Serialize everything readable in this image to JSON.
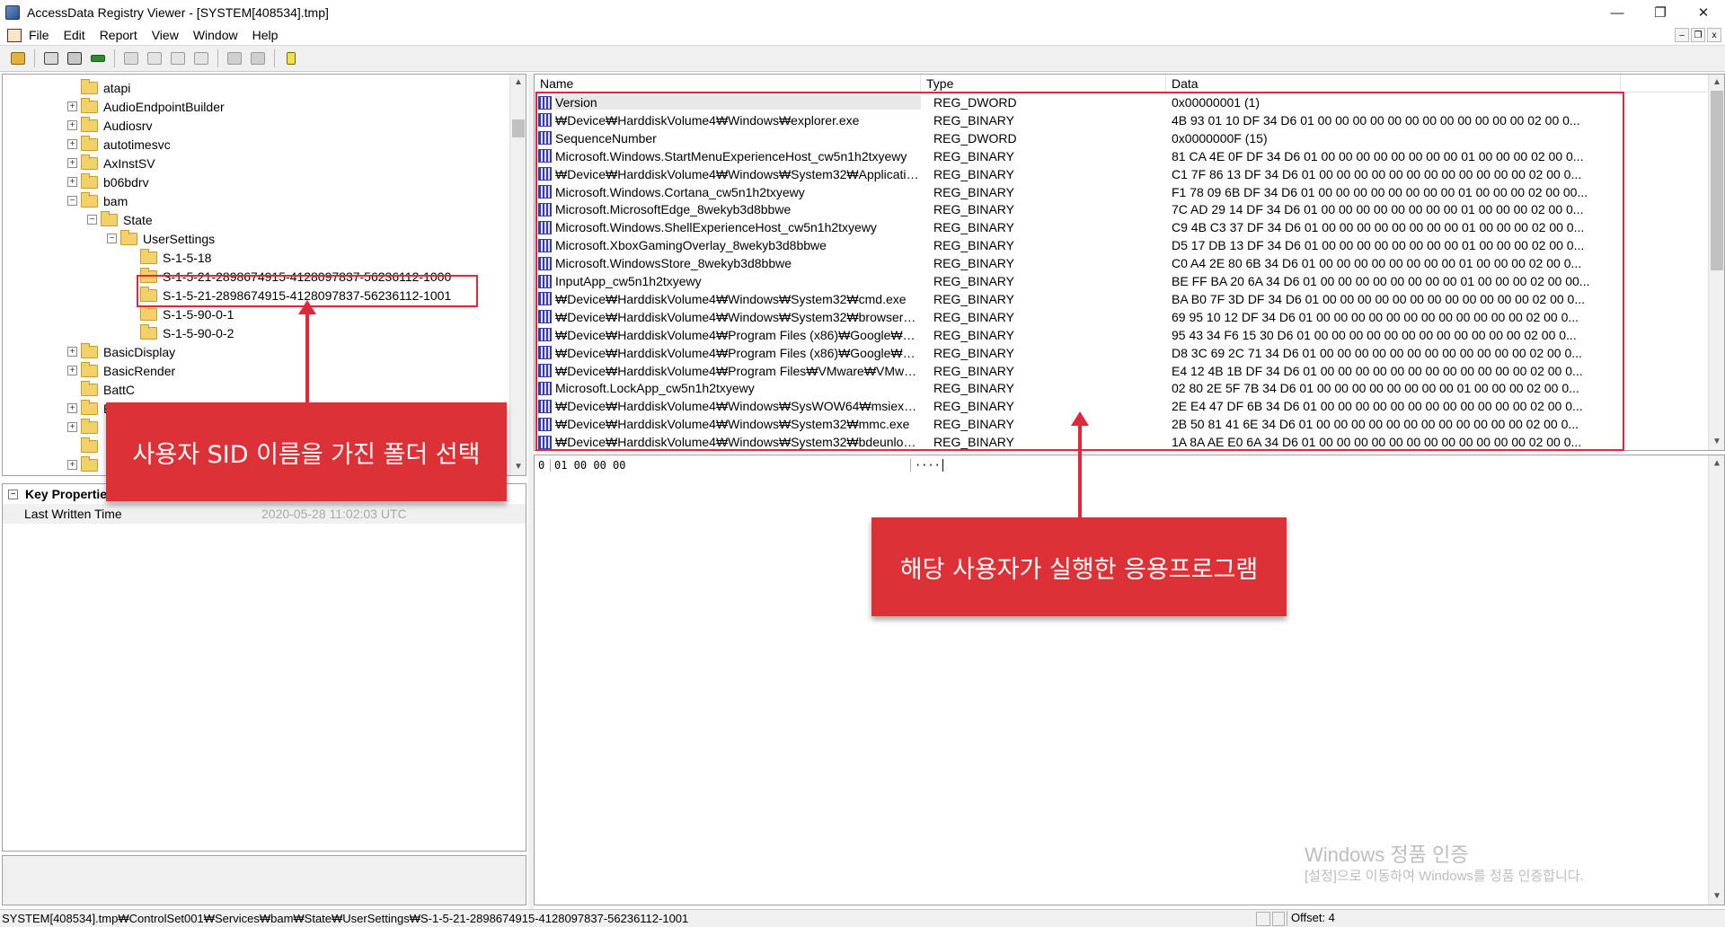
{
  "window": {
    "title": "AccessData Registry Viewer - [SYSTEM[408534].tmp]",
    "minimize_glyph": "—",
    "maximize_glyph": "❐",
    "close_glyph": "✕"
  },
  "menu": {
    "items": [
      "File",
      "Edit",
      "Report",
      "View",
      "Window",
      "Help"
    ],
    "mdi_min": "–",
    "mdi_restore": "❐",
    "mdi_close": "x"
  },
  "toolbar": {
    "icons": [
      "open-icon",
      "print-icon",
      "print-preview-icon",
      "key-icon",
      "export-icon",
      "report-icon",
      "report-add-icon",
      "report-remove-icon",
      "forward-icon",
      "back-icon",
      "help-icon"
    ]
  },
  "tree": {
    "expander_plus": "+",
    "expander_minus": "−",
    "items": [
      {
        "label": "atapi",
        "level": 1,
        "expander": "none"
      },
      {
        "label": "AudioEndpointBuilder",
        "level": 1,
        "expander": "plus"
      },
      {
        "label": "Audiosrv",
        "level": 1,
        "expander": "plus"
      },
      {
        "label": "autotimesvc",
        "level": 1,
        "expander": "plus"
      },
      {
        "label": "AxInstSV",
        "level": 1,
        "expander": "plus"
      },
      {
        "label": "b06bdrv",
        "level": 1,
        "expander": "plus"
      },
      {
        "label": "bam",
        "level": 1,
        "expander": "minus"
      },
      {
        "label": "State",
        "level": 2,
        "expander": "minus"
      },
      {
        "label": "UserSettings",
        "level": 3,
        "expander": "minus"
      },
      {
        "label": "S-1-5-18",
        "level": 4,
        "expander": "none"
      },
      {
        "label": "S-1-5-21-2898674915-4128097837-56236112-1000",
        "level": 4,
        "expander": "none"
      },
      {
        "label": "S-1-5-21-2898674915-4128097837-56236112-1001",
        "level": 4,
        "expander": "none",
        "selected": true
      },
      {
        "label": "S-1-5-90-0-1",
        "level": 4,
        "expander": "none"
      },
      {
        "label": "S-1-5-90-0-2",
        "level": 4,
        "expander": "none"
      },
      {
        "label": "BasicDisplay",
        "level": 1,
        "expander": "plus"
      },
      {
        "label": "BasicRender",
        "level": 1,
        "expander": "plus"
      },
      {
        "label": "BattC",
        "level": 1,
        "expander": "none"
      },
      {
        "label": "BcastDVRUserService",
        "level": 1,
        "expander": "plus"
      },
      {
        "label": "",
        "level": 1,
        "expander": "plus"
      },
      {
        "label": "",
        "level": 1,
        "expander": "none"
      },
      {
        "label": "",
        "level": 1,
        "expander": "plus"
      }
    ]
  },
  "key_properties": {
    "title": "Key Properties",
    "collapse": "−",
    "rows": [
      {
        "key": "Last Written Time",
        "value": "2020-05-28 11:02:03 UTC"
      }
    ]
  },
  "values_list": {
    "columns": [
      "Name",
      "Type",
      "Data"
    ],
    "rows": [
      {
        "name": "Version",
        "type": "REG_DWORD",
        "data": "0x00000001 (1)"
      },
      {
        "name": "₩Device₩HarddiskVolume4₩Windows₩explorer.exe",
        "type": "REG_BINARY",
        "data": "4B 93 01 10 DF 34 D6 01 00 00 00 00 00 00 00 00 00 00 00 00 02 00 0..."
      },
      {
        "name": "SequenceNumber",
        "type": "REG_DWORD",
        "data": "0x0000000F (15)"
      },
      {
        "name": "Microsoft.Windows.StartMenuExperienceHost_cw5n1h2txyewy",
        "type": "REG_BINARY",
        "data": "81 CA 4E 0F DF 34 D6 01 00 00 00 00 00 00 00 00 01 00 00 00 02 00 0..."
      },
      {
        "name": "₩Device₩HarddiskVolume4₩Windows₩System32₩Applicatio...",
        "type": "REG_BINARY",
        "data": "C1 7F 86 13 DF 34 D6 01 00 00 00 00 00 00 00 00 00 00 00 00 02 00 0..."
      },
      {
        "name": "Microsoft.Windows.Cortana_cw5n1h2txyewy",
        "type": "REG_BINARY",
        "data": "F1 78 09 6B DF 34 D6 01 00 00 00 00 00 00 00 00 01 00 00 00 02 00 00..."
      },
      {
        "name": "Microsoft.MicrosoftEdge_8wekyb3d8bbwe",
        "type": "REG_BINARY",
        "data": "7C AD 29 14 DF 34 D6 01 00 00 00 00 00 00 00 00 01 00 00 00 02 00 0..."
      },
      {
        "name": "Microsoft.Windows.ShellExperienceHost_cw5n1h2txyewy",
        "type": "REG_BINARY",
        "data": "C9 4B C3 37 DF 34 D6 01 00 00 00 00 00 00 00 00 01 00 00 00 02 00 0..."
      },
      {
        "name": "Microsoft.XboxGamingOverlay_8wekyb3d8bbwe",
        "type": "REG_BINARY",
        "data": "D5 17 DB 13 DF 34 D6 01 00 00 00 00 00 00 00 00 01 00 00 00 02 00 0..."
      },
      {
        "name": "Microsoft.WindowsStore_8wekyb3d8bbwe",
        "type": "REG_BINARY",
        "data": "C0 A4 2E 80 6B 34 D6 01 00 00 00 00 00 00 00 00 01 00 00 00 02 00 0..."
      },
      {
        "name": "InputApp_cw5n1h2txyewy",
        "type": "REG_BINARY",
        "data": "BE FF BA 20 6A 34 D6 01 00 00 00 00 00 00 00 00 01 00 00 00 02 00 00..."
      },
      {
        "name": "₩Device₩HarddiskVolume4₩Windows₩System32₩cmd.exe",
        "type": "REG_BINARY",
        "data": "BA B0 7F 3D DF 34 D6 01 00 00 00 00 00 00 00 00 00 00 00 00 02 00 0..."
      },
      {
        "name": "₩Device₩HarddiskVolume4₩Windows₩System32₩browser_br...",
        "type": "REG_BINARY",
        "data": "69 95 10 12 DF 34 D6 01 00 00 00 00 00 00 00 00 00 00 00 00 02 00 0..."
      },
      {
        "name": "₩Device₩HarddiskVolume4₩Program Files (x86)₩Google₩Up...",
        "type": "REG_BINARY",
        "data": "95 43 34 F6 15 30 D6 01 00 00 00 00 00 00 00 00 00 00 00 00 02 00 0..."
      },
      {
        "name": "₩Device₩HarddiskVolume4₩Program Files (x86)₩Google₩Chr...",
        "type": "REG_BINARY",
        "data": "D8 3C 69 2C 71 34 D6 01 00 00 00 00 00 00 00 00 00 00 00 00 02 00 0..."
      },
      {
        "name": "₩Device₩HarddiskVolume4₩Program Files₩VMware₩VMware...",
        "type": "REG_BINARY",
        "data": "E4 12 4B 1B DF 34 D6 01 00 00 00 00 00 00 00 00 00 00 00 00 02 00 0..."
      },
      {
        "name": "Microsoft.LockApp_cw5n1h2txyewy",
        "type": "REG_BINARY",
        "data": "02 80 2E 5F 7B 34 D6 01 00 00 00 00 00 00 00 00 01 00 00 00 02 00 0..."
      },
      {
        "name": "₩Device₩HarddiskVolume4₩Windows₩SysWOW64₩msiexec....",
        "type": "REG_BINARY",
        "data": "2E E4 47 DF 6B 34 D6 01 00 00 00 00 00 00 00 00 00 00 00 00 02 00 0..."
      },
      {
        "name": "₩Device₩HarddiskVolume4₩Windows₩System32₩mmc.exe",
        "type": "REG_BINARY",
        "data": "2B 50 81 41 6E 34 D6 01 00 00 00 00 00 00 00 00 00 00 00 00 02 00 0..."
      },
      {
        "name": "₩Device₩HarddiskVolume4₩Windows₩System32₩bdeunlock....",
        "type": "REG_BINARY",
        "data": "1A 8A AE E0 6A 34 D6 01 00 00 00 00 00 00 00 00 00 00 00 00 02 00 0..."
      }
    ]
  },
  "hex_view": {
    "offset": "0",
    "bytes": "01 00 00 00",
    "ascii": "····"
  },
  "status_bar": {
    "path": "SYSTEM[408534].tmp₩ControlSet001₩Services₩bam₩State₩UserSettings₩S-1-5-21-2898674915-4128097837-56236112-1001",
    "offset": "Offset: 4"
  },
  "annotations": {
    "left_callout": "사용자 SID 이름을 가진 폴더 선택",
    "right_callout": "해당 사용자가 실행한 응용프로그램",
    "color": "#dc3237"
  },
  "watermark": {
    "line1": "Windows 정품 인증",
    "line2": "[설정]으로 이동하여 Windows를 정품 인증합니다."
  }
}
